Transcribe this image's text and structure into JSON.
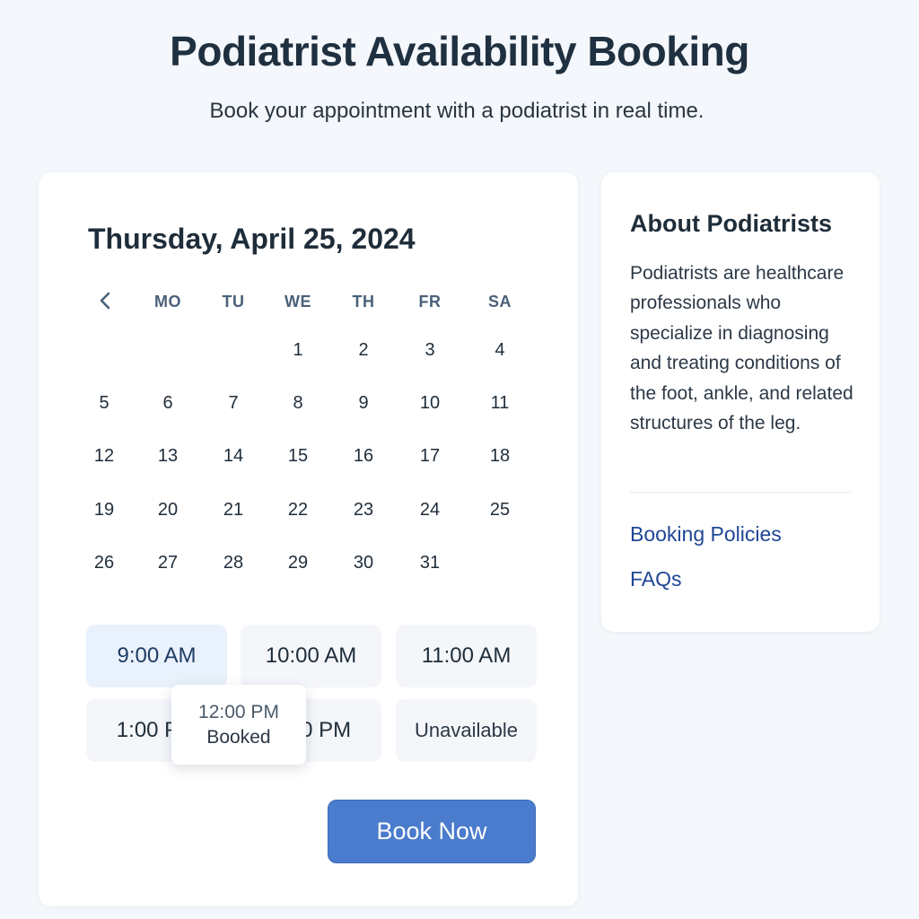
{
  "header": {
    "title": "Podiatrist Availability Booking",
    "subtitle": "Book your appointment with a podiatrist in real time."
  },
  "calendar": {
    "selected_date": "Thursday, April 25, 2024",
    "prev_icon": "chevron-left-icon",
    "weekdays": [
      "MO",
      "TU",
      "WE",
      "TH",
      "FR",
      "SA"
    ],
    "weeks": [
      [
        "",
        "",
        "",
        "1",
        "2",
        "3",
        "4"
      ],
      [
        "5",
        "6",
        "7",
        "8",
        "9",
        "10",
        "11"
      ],
      [
        "12",
        "13",
        "14",
        "15",
        "16",
        "17",
        "18"
      ],
      [
        "19",
        "20",
        "21",
        "22",
        "23",
        "24",
        "25"
      ],
      [
        "26",
        "27",
        "28",
        "29",
        "30",
        "31",
        ""
      ]
    ]
  },
  "time_slots": [
    {
      "label": "9:00 AM",
      "state": "selected"
    },
    {
      "label": "10:00 AM",
      "state": "available"
    },
    {
      "label": "11:00 AM",
      "state": "available"
    },
    {
      "label": "1:00 PM",
      "state": "available"
    },
    {
      "label": "2:00 PM",
      "state": "available"
    },
    {
      "label": "Unavailable",
      "state": "unavailable"
    }
  ],
  "tooltip": {
    "time": "12:00 PM",
    "status": "Booked"
  },
  "book_button": "Book Now",
  "sidebar": {
    "title": "About Podiatrists",
    "description": "Podiatrists are healthcare professionals who specialize in diagnosing and treating conditions of the foot, ankle, and related structures of the leg.",
    "links": [
      "Booking Policies",
      "FAQs"
    ]
  },
  "colors": {
    "accent": "#4a7bcc",
    "link": "#1e4694",
    "selected_slot": "#e9f1fc"
  }
}
